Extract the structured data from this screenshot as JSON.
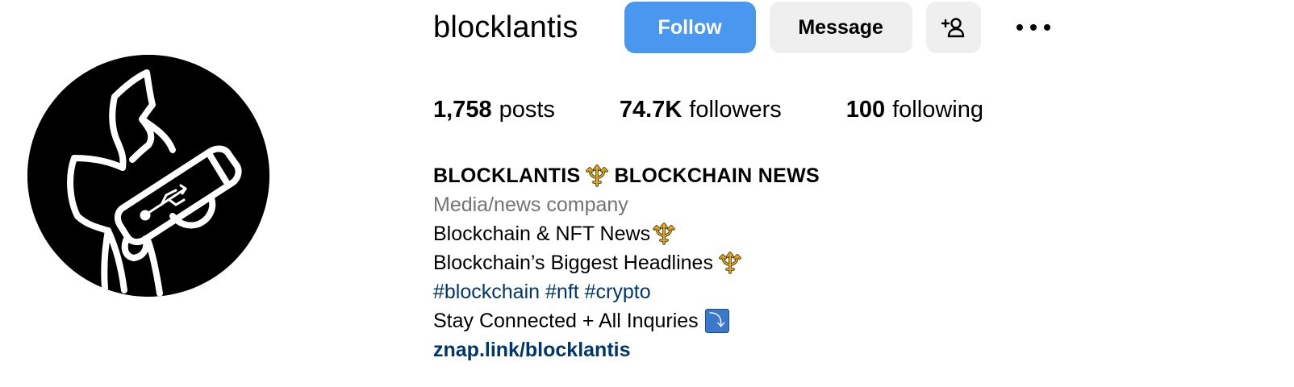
{
  "profile": {
    "username": "blocklantis",
    "buttons": {
      "follow": "Follow",
      "message": "Message"
    },
    "icons": {
      "add_user": "add-user-icon",
      "more": "more-options-icon",
      "avatar": "usb-holding-figure-logo"
    },
    "stats": {
      "posts_count": "1,758",
      "posts_label": "posts",
      "followers_count": "74.7K",
      "followers_label": "followers",
      "following_count": "100",
      "following_label": "following"
    },
    "bio": {
      "name_part1": "BLOCKLANTIS",
      "name_part2": "BLOCKCHAIN NEWS",
      "category": "Media/news company",
      "line1": "Blockchain & NFT News",
      "line2": "Blockchain’s Biggest Headlines",
      "hashtags": [
        "#blockchain",
        "#nft",
        "#crypto"
      ],
      "line4": "Stay Connected + All Inquries",
      "link": "znap.link/blocklantis"
    }
  },
  "colors": {
    "follow_button": "#4a97f0",
    "secondary_button": "#efefef",
    "category_text": "#737373",
    "link_text": "#00376b",
    "trident_gold": "#e0a81a"
  }
}
